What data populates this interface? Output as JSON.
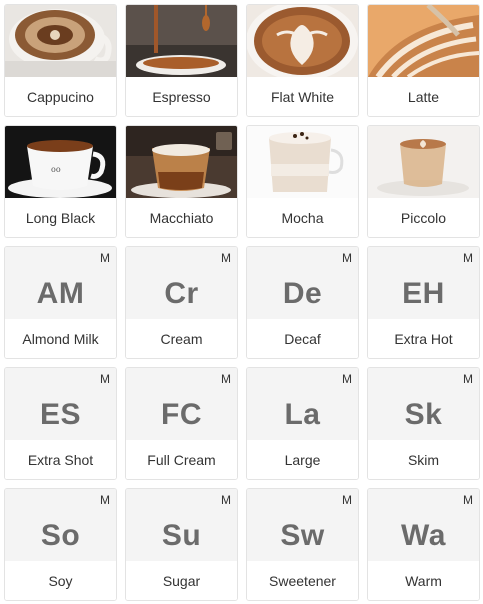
{
  "drinks": [
    {
      "label": "Cappucino",
      "icon": "cappuccino-photo"
    },
    {
      "label": "Espresso",
      "icon": "espresso-photo"
    },
    {
      "label": "Flat White",
      "icon": "flat-white-photo"
    },
    {
      "label": "Latte",
      "icon": "latte-photo"
    },
    {
      "label": "Long Black",
      "icon": "long-black-photo"
    },
    {
      "label": "Macchiato",
      "icon": "macchiato-photo"
    },
    {
      "label": "Mocha",
      "icon": "mocha-photo"
    },
    {
      "label": "Piccolo",
      "icon": "piccolo-photo"
    }
  ],
  "modifiers": [
    {
      "code": "AM",
      "label": "Almond Milk",
      "flag": "M"
    },
    {
      "code": "Cr",
      "label": "Cream",
      "flag": "M"
    },
    {
      "code": "De",
      "label": "Decaf",
      "flag": "M"
    },
    {
      "code": "EH",
      "label": "Extra Hot",
      "flag": "M"
    },
    {
      "code": "ES",
      "label": "Extra Shot",
      "flag": "M"
    },
    {
      "code": "FC",
      "label": "Full Cream",
      "flag": "M"
    },
    {
      "code": "La",
      "label": "Large",
      "flag": "M"
    },
    {
      "code": "Sk",
      "label": "Skim",
      "flag": "M"
    },
    {
      "code": "So",
      "label": "Soy",
      "flag": "M"
    },
    {
      "code": "Su",
      "label": "Sugar",
      "flag": "M"
    },
    {
      "code": "Sw",
      "label": "Sweetener",
      "flag": "M"
    },
    {
      "code": "Wa",
      "label": "Warm",
      "flag": "M"
    }
  ]
}
